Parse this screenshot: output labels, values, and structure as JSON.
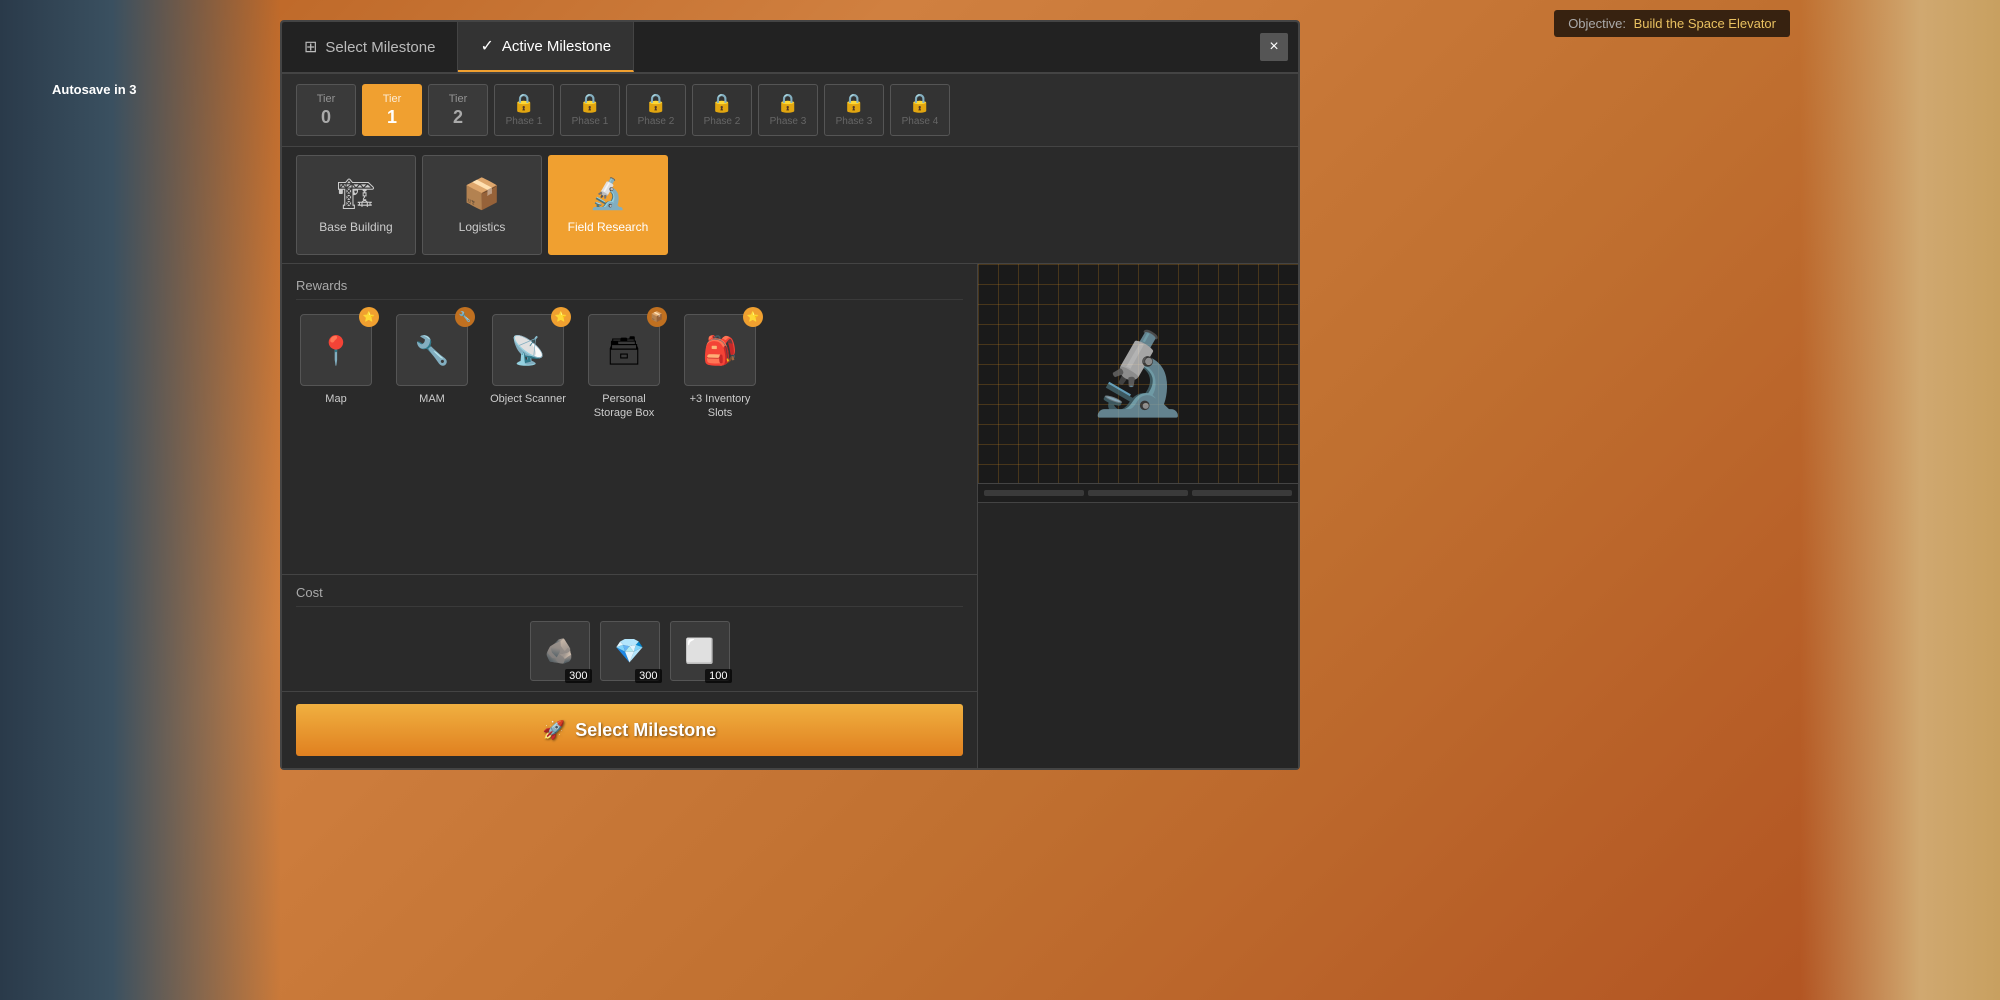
{
  "autosave": "Autosave in 3",
  "objective": {
    "label": "Objective:",
    "text": "Build the Space Elevator"
  },
  "tabs": [
    {
      "id": "select",
      "label": "Select Milestone",
      "icon": "⊞",
      "active": false
    },
    {
      "id": "active",
      "label": "Active Milestone",
      "icon": "✓",
      "active": true
    }
  ],
  "close_btn": "×",
  "tiers": [
    {
      "label": "Tier",
      "num": "0",
      "locked": false,
      "active": false
    },
    {
      "label": "Tier",
      "num": "1",
      "locked": false,
      "active": true
    },
    {
      "label": "Tier",
      "num": "2",
      "locked": false,
      "active": false
    },
    {
      "label": "Phase 1",
      "num": "🔒",
      "locked": true
    },
    {
      "label": "Phase 1",
      "num": "🔒",
      "locked": true
    },
    {
      "label": "Phase 2",
      "num": "🔒",
      "locked": true
    },
    {
      "label": "Phase 2",
      "num": "🔒",
      "locked": true
    },
    {
      "label": "Phase 3",
      "num": "🔒",
      "locked": true
    },
    {
      "label": "Phase 3",
      "num": "🔒",
      "locked": true
    },
    {
      "label": "Phase 4",
      "num": "🔒",
      "locked": true
    }
  ],
  "milestones": [
    {
      "id": "base_building",
      "label": "Base Building",
      "icon": "🏗",
      "active": false
    },
    {
      "id": "logistics",
      "label": "Logistics",
      "icon": "📦",
      "active": false
    },
    {
      "id": "field_research",
      "label": "Field Research",
      "icon": "🔬",
      "active": true
    }
  ],
  "rewards_title": "Rewards",
  "rewards": [
    {
      "id": "map",
      "label": "Map",
      "icon": "📍",
      "badge": "⭐"
    },
    {
      "id": "mam",
      "label": "MAM",
      "icon": "🔧",
      "badge": "🟠"
    },
    {
      "id": "object_scanner",
      "label": "Object Scanner",
      "icon": "📡",
      "badge": "⭐"
    },
    {
      "id": "personal_storage",
      "label": "Personal Storage Box",
      "icon": "📦",
      "badge": "🟠"
    },
    {
      "id": "inventory_slots",
      "label": "+3 Inventory Slots",
      "icon": "🎒",
      "badge": "⭐"
    }
  ],
  "cost_title": "Cost",
  "costs": [
    {
      "id": "material1",
      "icon": "🪨",
      "amount": "300"
    },
    {
      "id": "material2",
      "icon": "💎",
      "amount": "300"
    },
    {
      "id": "material3",
      "icon": "⬜",
      "amount": "100"
    }
  ],
  "select_btn": "Select Milestone",
  "select_btn_icon": "🚀"
}
